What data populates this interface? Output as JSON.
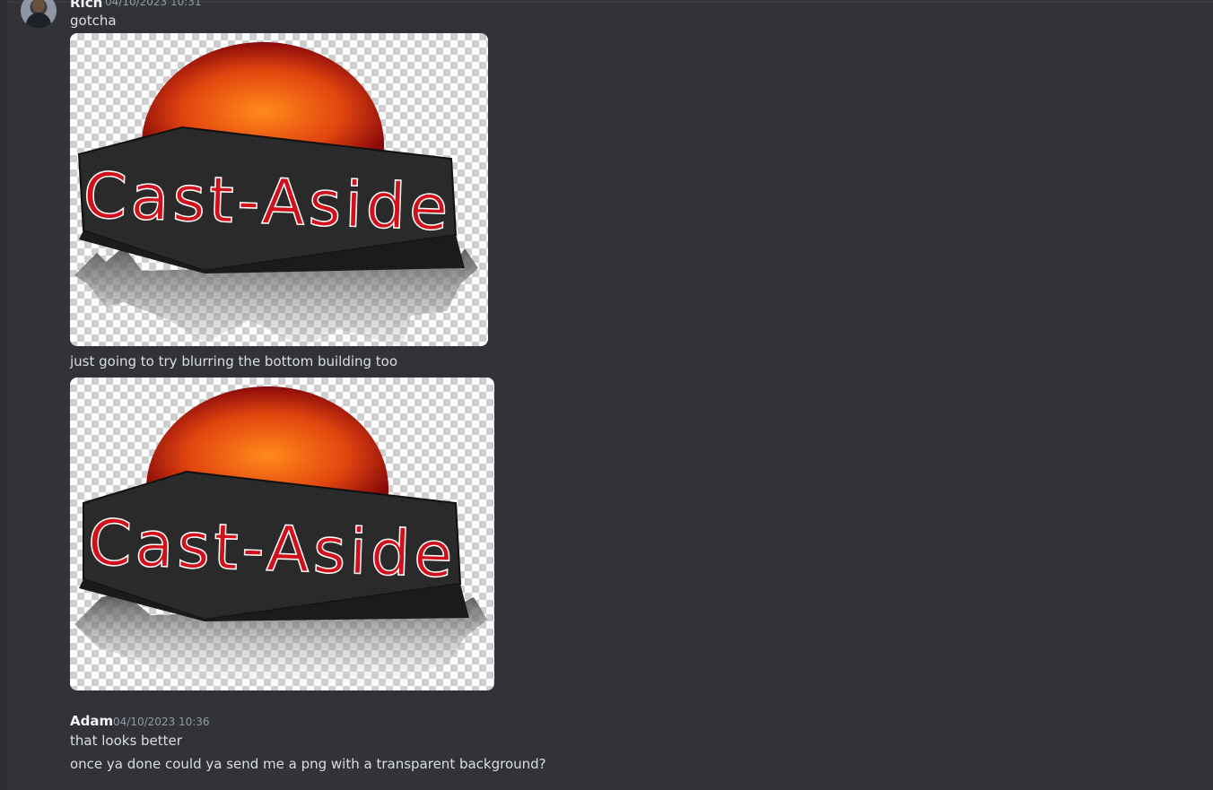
{
  "messages": [
    {
      "author": "Rich",
      "timestamp": "04/10/2023 10:31",
      "lines": [
        "gotcha",
        "just going to try blurring the bottom building too"
      ],
      "attachments": [
        {
          "alt": "Cast-Aside logo",
          "logo_text": "Cast-Aside"
        },
        {
          "alt": "Cast-Aside logo",
          "logo_text": "Cast-Aside"
        }
      ]
    },
    {
      "author": "Adam",
      "timestamp": "04/10/2023 10:36",
      "lines": [
        "that looks better",
        "once ya done could ya send me a png with a transparent background?"
      ]
    }
  ],
  "colors": {
    "background": "#313338",
    "username": "#f2f3f5",
    "timestamp": "#949ba4",
    "text": "#dbdee1",
    "logo_red": "#d0101a",
    "logo_plate": "#2a2a2a"
  }
}
